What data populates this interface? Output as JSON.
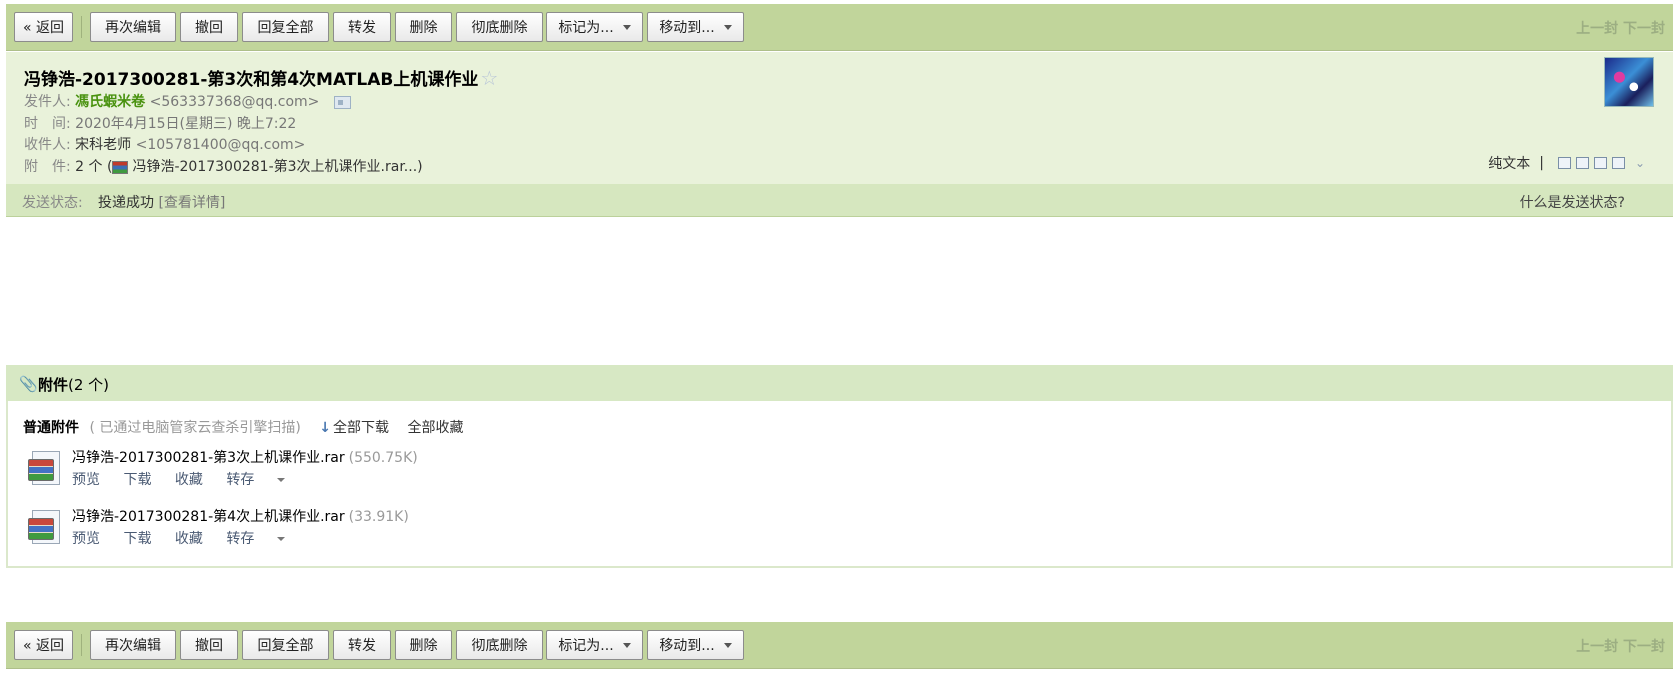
{
  "toolbar": {
    "back": "« 返回",
    "edit_again": "再次编辑",
    "recall": "撤回",
    "reply_all": "回复全部",
    "forward": "转发",
    "delete": "删除",
    "delete_permanent": "彻底删除",
    "mark_as": "标记为...",
    "move_to": "移动到...",
    "prev": "上一封",
    "next": "下一封"
  },
  "mail": {
    "subject": "冯铮浩-2017300281-第3次和第4次MATLAB上机课作业",
    "star": "☆",
    "from_label": "发件人:",
    "from_name": "馮氏蝦米卷",
    "from_email": "<563337368@qq.com>",
    "time_label": "时　间:",
    "time_value": "2020年4月15日(星期三) 晚上7:22",
    "to_label": "收件人:",
    "to_name": "宋科老师",
    "to_email": "<105781400@qq.com>",
    "att_label": "附　件:",
    "att_count": "2 个 (",
    "att_first": "冯铮浩-2017300281-第3次上机课作业.rar...",
    "att_close": ")",
    "plain_text": "纯文本",
    "pipe": "|"
  },
  "status": {
    "label": "发送状态:",
    "value": "投递成功",
    "detail": "[查看详情]",
    "help": "什么是发送状态?"
  },
  "attachments": {
    "title": "附件",
    "count": "(2 个)",
    "group_name": "普通附件",
    "scan_note": "( 已通过电脑管家云查杀引擎扫描)",
    "download_all": "全部下载",
    "save_all": "全部收藏",
    "items": [
      {
        "name": "冯铮浩-2017300281-第3次上机课作业.rar",
        "size": "(550.75K)",
        "preview": "预览",
        "download": "下载",
        "favorite": "收藏",
        "save_to": "转存"
      },
      {
        "name": "冯铮浩-2017300281-第4次上机课作业.rar",
        "size": "(33.91K)",
        "preview": "预览",
        "download": "下载",
        "favorite": "收藏",
        "save_to": "转存"
      }
    ]
  },
  "icons": {
    "paperclip": "paperclip-icon",
    "shield": "shield-icon",
    "download_arrow": "download-arrow-icon",
    "rar": "rar-archive-icon",
    "contact_card": "contact-card-icon"
  },
  "colors": {
    "toolbar_bg": "#c1d59b",
    "header_bg": "#e9f2da",
    "sender_green": "#49920f",
    "status_bar_bg": "#d6e7bf"
  }
}
